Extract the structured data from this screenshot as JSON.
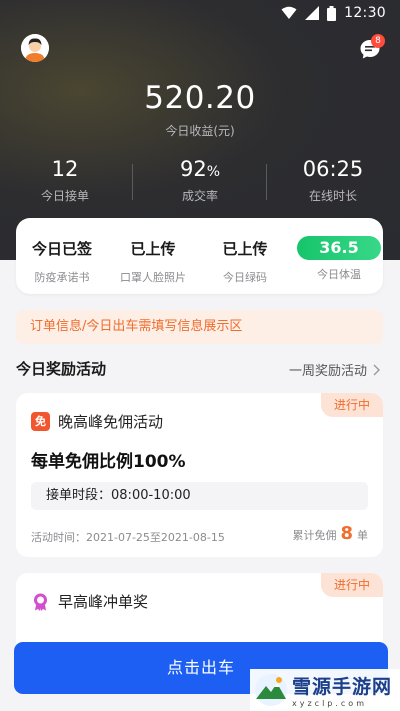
{
  "status_bar": {
    "time": "12:30"
  },
  "header": {
    "unread_count": "8",
    "income_value": "520.20",
    "income_label": "今日收益(元)",
    "stats": [
      {
        "value": "12",
        "unit": "",
        "label": "今日接单"
      },
      {
        "value": "92",
        "unit": "%",
        "label": "成交率"
      },
      {
        "value": "06:25",
        "unit": "",
        "label": "在线时长"
      }
    ]
  },
  "status_card": {
    "items": [
      {
        "value": "今日已签",
        "label": "防疫承诺书"
      },
      {
        "value": "已上传",
        "label": "口罩人脸照片"
      },
      {
        "value": "已上传",
        "label": "今日绿码"
      },
      {
        "value": "36.5",
        "label": "今日体温"
      }
    ]
  },
  "notice": {
    "text": "订单信息/今日出车需填写信息展示区"
  },
  "rewards": {
    "title": "今日奖励活动",
    "link": "一周奖励活动",
    "activities": [
      {
        "tag": "进行中",
        "icon_text": "免",
        "name": "晚高峰免佣活动",
        "desc": "每单免佣比例100%",
        "time_label": "接单时段：",
        "time_value": "08:00-10:00",
        "period": "活动时间：2021-07-25至2021-08-15",
        "count_prefix": "累计免佣",
        "count": "8",
        "count_suffix": "单"
      },
      {
        "tag": "进行中",
        "name": "早高峰冲单奖"
      }
    ]
  },
  "action": {
    "go_button": "点击出车"
  },
  "watermark": {
    "main": "雪源手游网",
    "sub": "xyzclp.com"
  },
  "colors": {
    "accent": "#1d5ff2",
    "orange": "#f06d2d",
    "green": "#16c46a",
    "header_bg": "#2d2d30"
  }
}
